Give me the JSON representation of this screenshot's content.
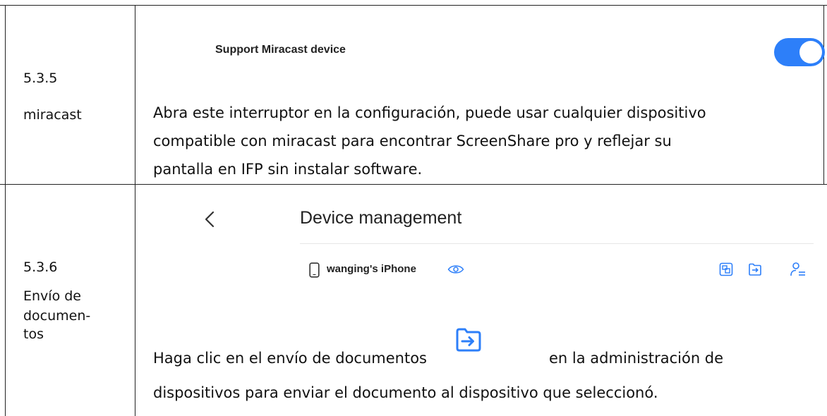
{
  "row1": {
    "section_number": "5.3.5",
    "section_name": "miracast",
    "setting_label": "Support Miracast device",
    "toggle_on": true,
    "toggle_color": "#2d7ff9",
    "description_lines": [
      "Abra este interruptor en la configuración, puede usar cualquier dispositivo",
      "compatible con miracast para encontrar ScreenShare pro y reflejar su",
      "pantalla en IFP sin instalar software."
    ]
  },
  "row2": {
    "section_number": "5.3.6",
    "section_name_lines": [
      "Envío de",
      "documen-",
      "tos"
    ],
    "screen_title": "Device management",
    "device_name": "wanging's iPhone",
    "icons": [
      "back-chevron-icon",
      "phone-icon",
      "eye-icon",
      "screen-mirror-icon",
      "send-document-icon",
      "user-list-icon"
    ],
    "accent_color": "#2d7ff9",
    "description_before_icon": "Haga clic en el envío de documentos",
    "description_after_icon": "en la administración de",
    "description_line2": "dispositivos para enviar el documento al dispositivo que seleccionó."
  }
}
